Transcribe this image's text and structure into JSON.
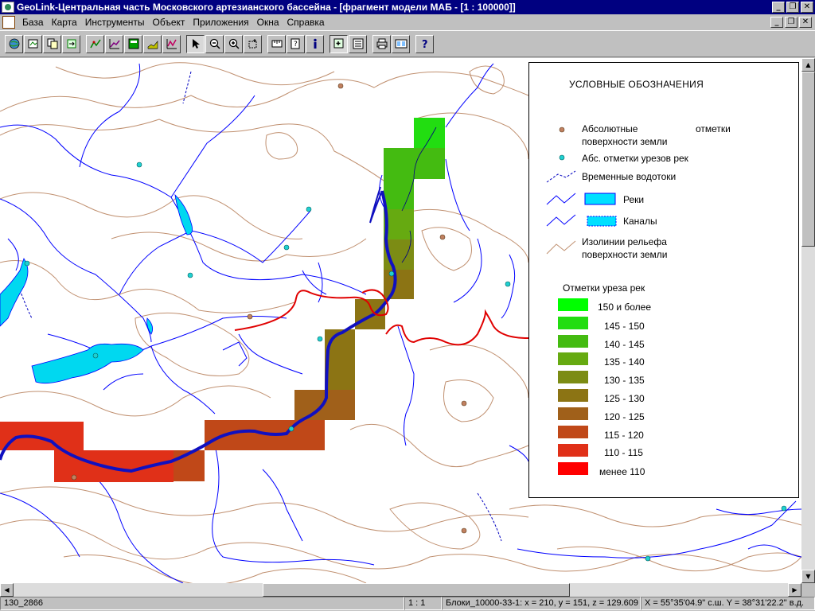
{
  "window": {
    "title": "GeoLink-Центральная часть Московского артезианского бассейна - [фрагмент модели МАБ - [1 : 100000]]"
  },
  "menu": [
    "База",
    "Карта",
    "Инструменты",
    "Объект",
    "Приложения",
    "Окна",
    "Справка"
  ],
  "toolbar": {
    "buttons": [
      "open-map",
      "save-map",
      "copy",
      "export",
      "layer-edit",
      "chart",
      "table",
      "profile",
      "graph",
      "select",
      "zoom-out",
      "zoom-in",
      "zoom-window",
      "measure",
      "query",
      "info",
      "add-layer",
      "properties",
      "print",
      "print-preview",
      "help"
    ]
  },
  "legend": {
    "title": "УСЛОВНЫЕ ОБОЗНАЧЕНИЯ",
    "items": [
      {
        "label_1": "Абсолютные",
        "label_2": "отметки",
        "label_3": "поверхности земли",
        "symbol": "brown-dot",
        "color": "#c08060"
      },
      {
        "label": "Абс. отметки урезов рек",
        "symbol": "cyan-dot",
        "color": "#20d0d0"
      },
      {
        "label": "Временные водотоки",
        "symbol": "dashed-line",
        "color": "#0000c0"
      },
      {
        "label": "Реки",
        "symbol": "river-polygon",
        "color": "#00e0ff"
      },
      {
        "label": "Каналы",
        "symbol": "canal-polygon",
        "color": "#00e0ff"
      },
      {
        "label_1": "Изолинии рельефа",
        "label_2": "поверхности земли",
        "symbol": "contour-line",
        "color": "#c09070"
      }
    ],
    "scale_title": "Отметки уреза рек",
    "scale": [
      {
        "label": "150 и более",
        "color": "#00ff00"
      },
      {
        "label": "145 - 150",
        "color": "#22dd11"
      },
      {
        "label": "140 - 145",
        "color": "#44bb11"
      },
      {
        "label": "135 - 140",
        "color": "#66aa11"
      },
      {
        "label": "130 - 135",
        "color": "#7c8c14"
      },
      {
        "label": "125 - 130",
        "color": "#8c7414"
      },
      {
        "label": "120 - 125",
        "color": "#a0601a"
      },
      {
        "label": "115 - 120",
        "color": "#c04818"
      },
      {
        "label": "110 - 115",
        "color": "#e03018"
      },
      {
        "label": "менее 110",
        "color": "#ff0000"
      }
    ]
  },
  "status": {
    "object": "130_2866",
    "scale": "1 : 1",
    "block": "Блоки_10000-33-1: x = 210, y = 151, z = 129.609",
    "coords": "X = 55°35'04.9\" с.ш.  Y = 38°31'22.2\" в.д."
  },
  "colors": {
    "river": "#0000ff",
    "main_river": "#1010c0",
    "contour": "#c09070",
    "boundary": "#e00000",
    "water": "#00d8f0"
  }
}
